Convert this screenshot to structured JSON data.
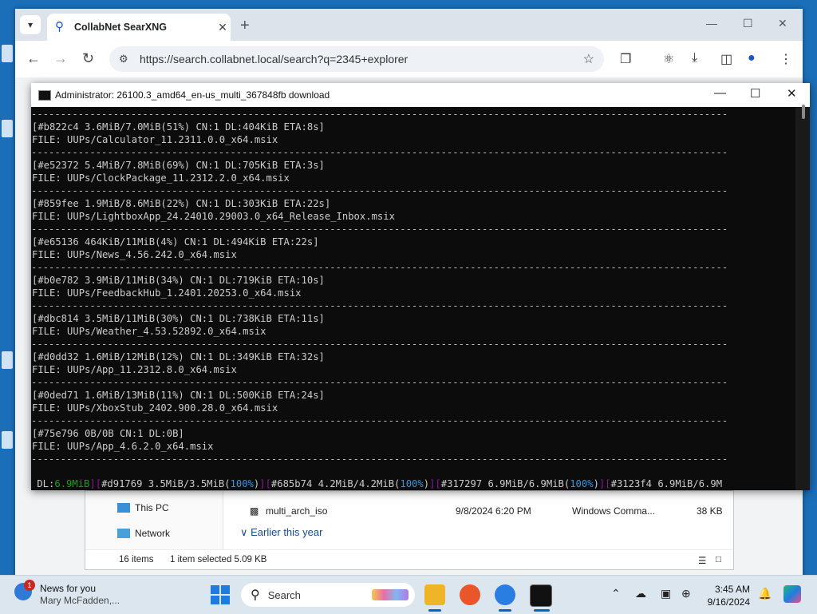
{
  "browser": {
    "tab_title": "CollabNet SearXNG",
    "url": "https://search.collabnet.local/search?q=2345+explorer"
  },
  "console": {
    "title": "Administrator:  26100.3_amd64_en-us_multi_367848fb download",
    "separator": "-----------------------------------------------------------------------------------------------------------------------",
    "entries": [
      {
        "status": "[#b822c4 3.6MiB/7.0MiB(51%) CN:1 DL:404KiB ETA:8s]",
        "file": "FILE: UUPs/Calculator_11.2311.0.0_x64.msix"
      },
      {
        "status": "[#e52372 5.4MiB/7.8MiB(69%) CN:1 DL:705KiB ETA:3s]",
        "file": "FILE: UUPs/ClockPackage_11.2312.2.0_x64.msix"
      },
      {
        "status": "[#859fee 1.9MiB/8.6MiB(22%) CN:1 DL:303KiB ETA:22s]",
        "file": "FILE: UUPs/LightboxApp_24.24010.29003.0_x64_Release_Inbox.msix"
      },
      {
        "status": "[#e65136 464KiB/11MiB(4%) CN:1 DL:494KiB ETA:22s]",
        "file": "FILE: UUPs/News_4.56.242.0_x64.msix"
      },
      {
        "status": "[#b0e782 3.9MiB/11MiB(34%) CN:1 DL:719KiB ETA:10s]",
        "file": "FILE: UUPs/FeedbackHub_1.2401.20253.0_x64.msix"
      },
      {
        "status": "[#dbc814 3.5MiB/11MiB(30%) CN:1 DL:738KiB ETA:11s]",
        "file": "FILE: UUPs/Weather_4.53.52892.0_x64.msix"
      },
      {
        "status": "[#d0dd32 1.6MiB/12MiB(12%) CN:1 DL:349KiB ETA:32s]",
        "file": "FILE: UUPs/App_11.2312.8.0_x64.msix"
      },
      {
        "status": "[#0ded71 1.6MiB/13MiB(11%) CN:1 DL:500KiB ETA:24s]",
        "file": "FILE: UUPs/XboxStub_2402.900.28.0_x64.msix"
      },
      {
        "status": "[#75e796 0B/0B CN:1 DL:0B]",
        "file": "FILE: UUPs/App_4.6.2.0_x64.msix"
      }
    ],
    "statusbar": {
      "dl_label": "DL:",
      "dl_value": "6.9MiB",
      "items": [
        {
          "id": "#d91769",
          "size": "3.5MiB/3.5MiB",
          "pct": "100%"
        },
        {
          "id": "#685b74",
          "size": "4.2MiB/4.2MiB",
          "pct": "100%"
        },
        {
          "id": "#317297",
          "size": "6.9MiB/6.9MiB",
          "pct": "100%"
        },
        {
          "id": "#3123f4",
          "size": "6.9MiB/6.9M",
          "pct": ""
        }
      ]
    }
  },
  "explorer": {
    "nav_this_pc": "This PC",
    "nav_network": "Network",
    "file_name": "multi_arch_iso",
    "file_date": "9/8/2024 6:20 PM",
    "file_type": "Windows Comma...",
    "file_size": "38 KB",
    "group_label": "Earlier this year",
    "items_count": "16 items",
    "selection": "1 item selected  5.09 KB"
  },
  "taskbar": {
    "news_title": "News for you",
    "news_sub": "Mary McFadden,...",
    "news_badge": "1",
    "search_label": "Search",
    "time": "3:45 AM",
    "date": "9/16/2024"
  }
}
